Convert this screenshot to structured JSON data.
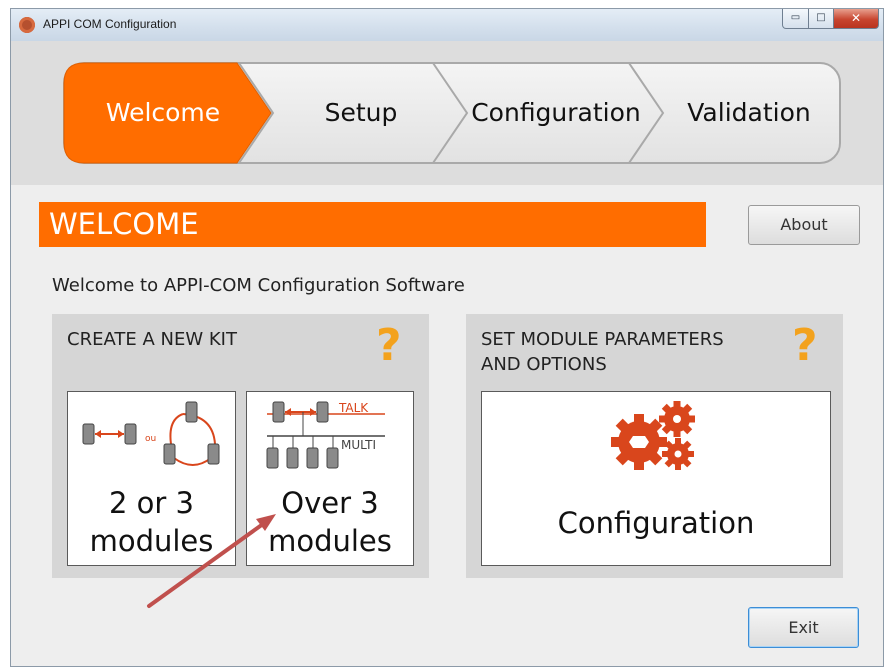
{
  "window": {
    "title": "APPI COM Configuration",
    "controls": {
      "minimize": "▭",
      "maximize": "□",
      "close": "✕"
    }
  },
  "wizard": {
    "steps": [
      {
        "label": "Welcome",
        "active": true
      },
      {
        "label": "Setup",
        "active": false
      },
      {
        "label": "Configuration",
        "active": false
      },
      {
        "label": "Validation",
        "active": false
      }
    ],
    "accent": "#ff6d00"
  },
  "banner": {
    "title": "WELCOME"
  },
  "buttons": {
    "about": "About",
    "exit": "Exit"
  },
  "intro": "Welcome to APPI-COM Configuration Software",
  "kit_panel": {
    "title": "CREATE A NEW KIT",
    "help_icon": "question-mark-icon",
    "tiles": [
      {
        "line1": "2 or 3",
        "line2": "modules",
        "diagram_label": "ou"
      },
      {
        "line1": "Over 3",
        "line2": "modules",
        "talk_label": "TALK",
        "multi_label": "MULTI"
      }
    ]
  },
  "params_panel": {
    "title_line1": "SET MODULE PARAMETERS",
    "title_line2": "AND OPTIONS",
    "help_icon": "question-mark-icon",
    "tile": {
      "label": "Configuration",
      "icon": "gears-icon"
    }
  },
  "colors": {
    "accent_orange": "#ff6d00",
    "help_orange": "#f3a21d",
    "gear_red": "#d9461c",
    "annotation_arrow": "#c0504d"
  }
}
